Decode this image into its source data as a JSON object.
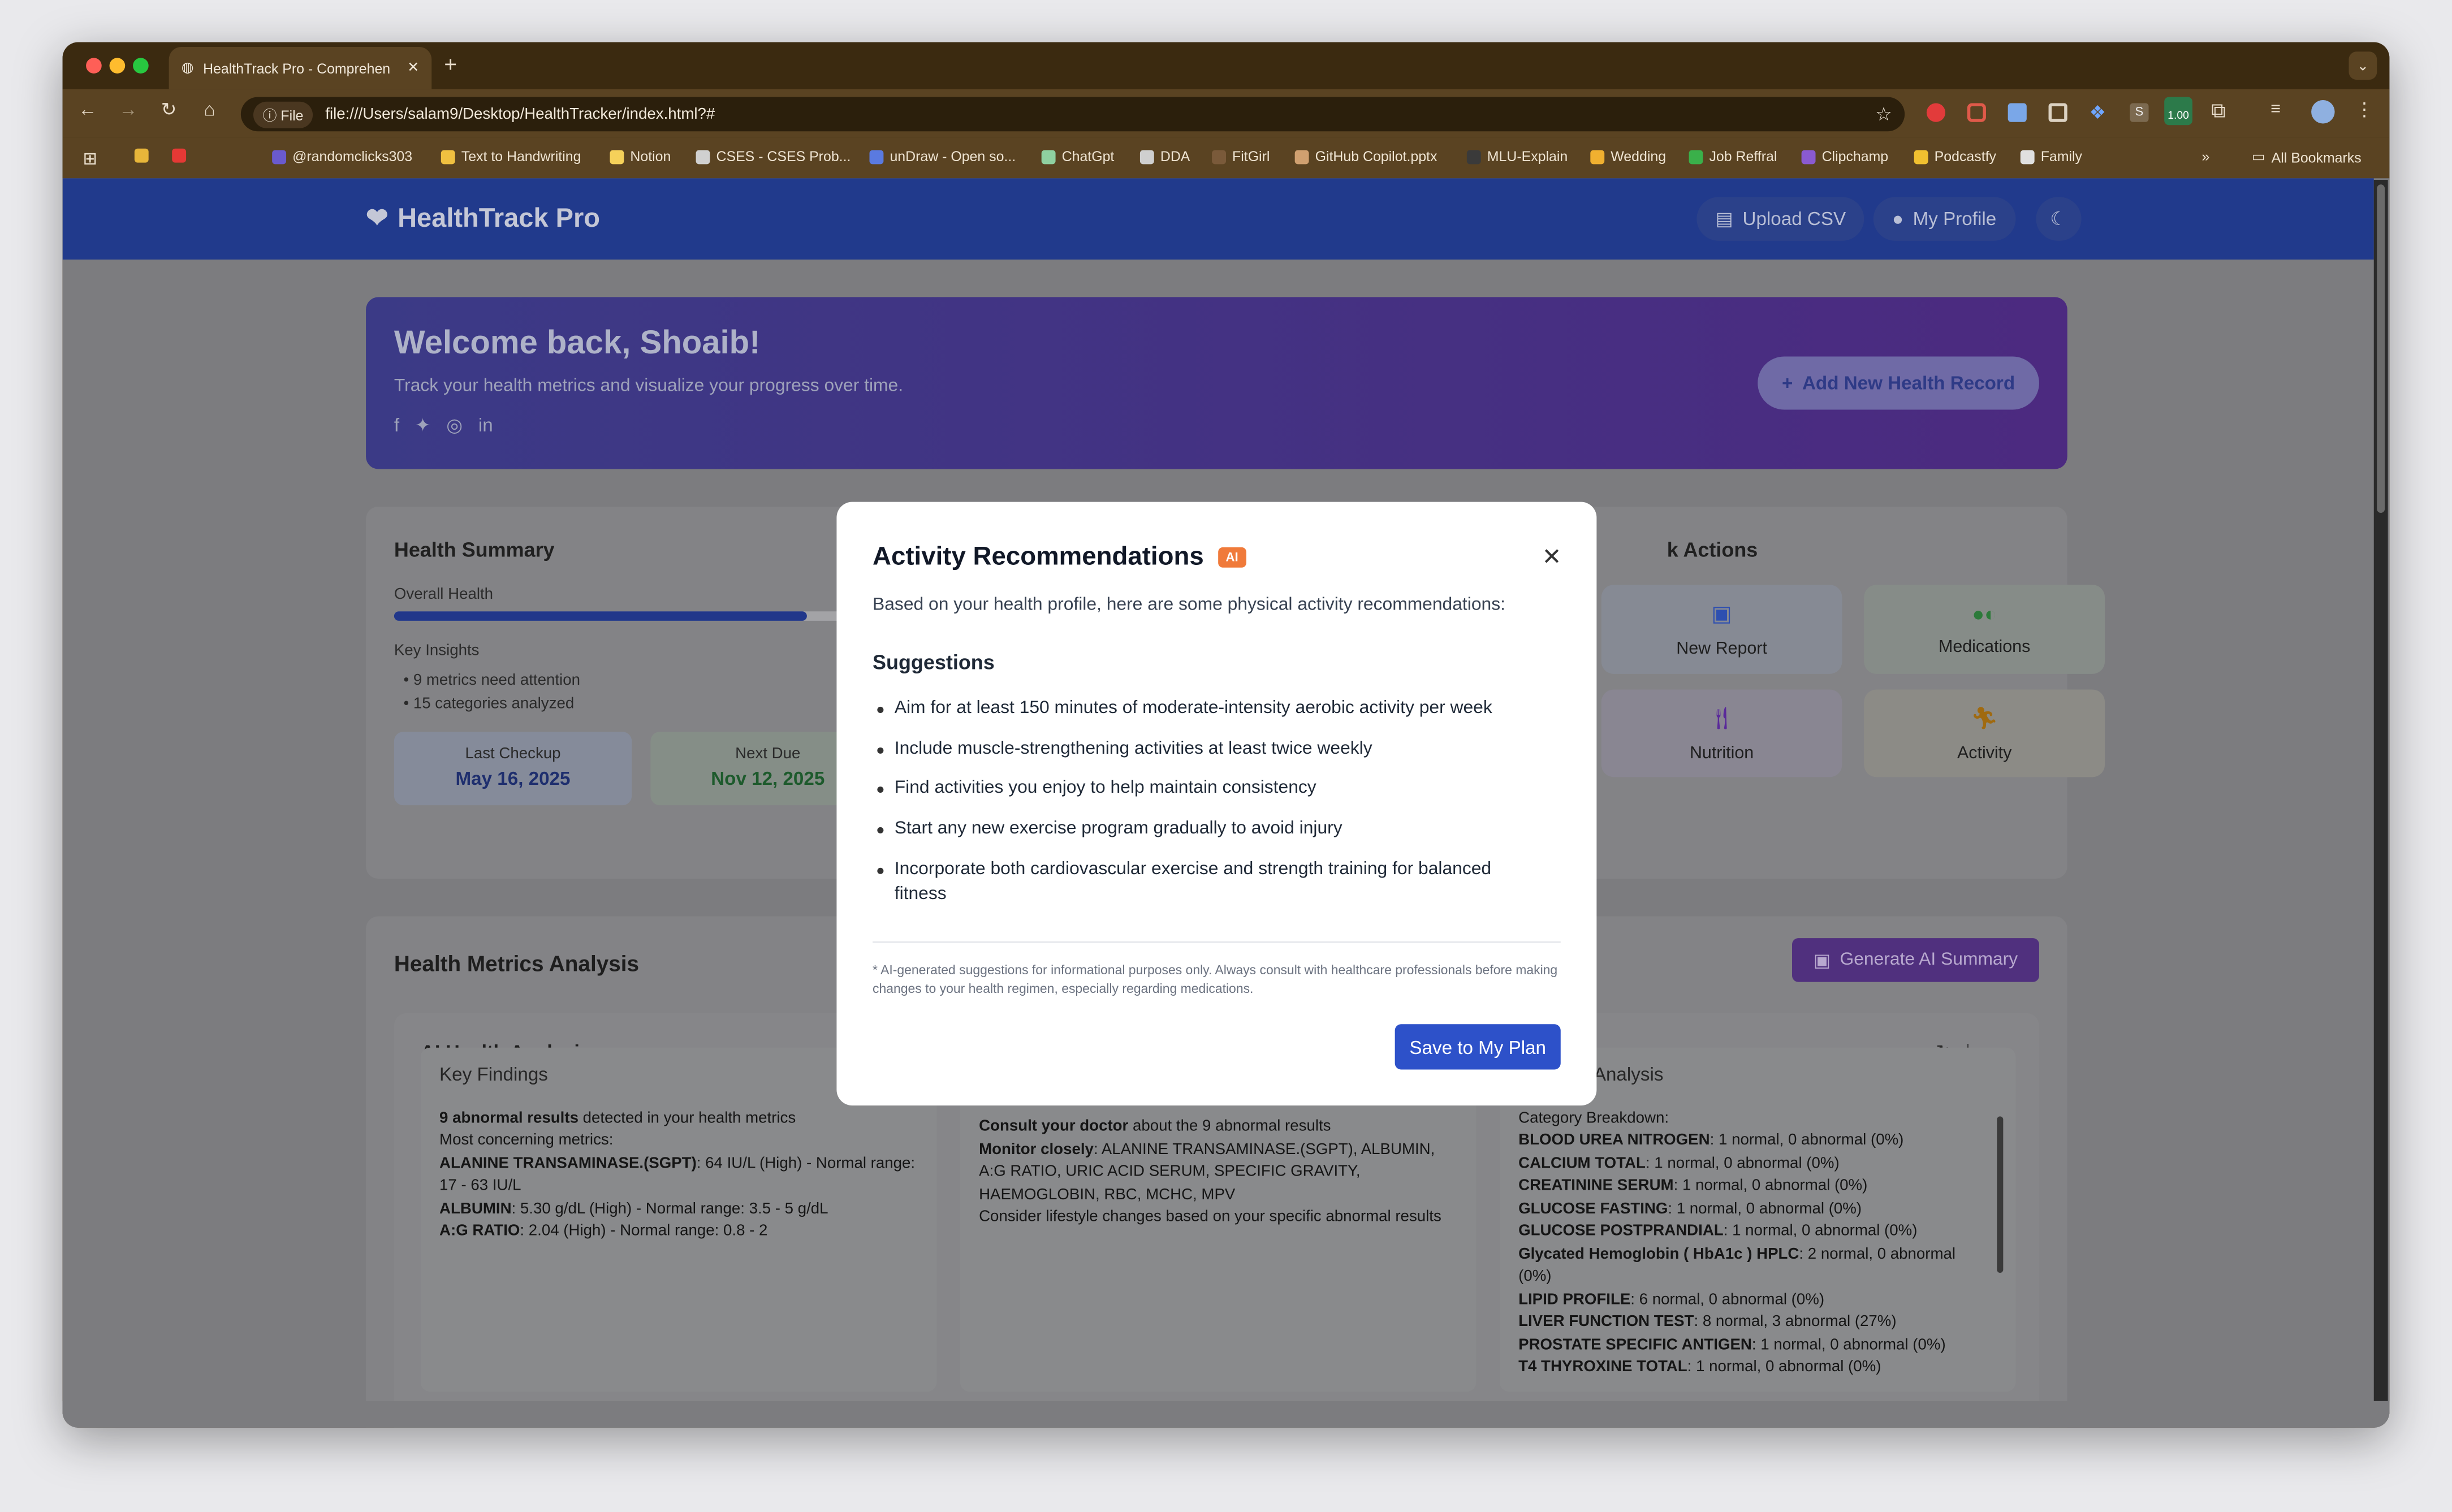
{
  "browser": {
    "tab_title": "HealthTrack Pro - Comprehen",
    "url_chip": "File",
    "url": "file:///Users/salam9/Desktop/HealthTracker/index.html?#",
    "ext_badge": "1.00",
    "bookmarks": [
      "@randomclicks303",
      "Text to Handwriting",
      "Notion",
      "CSES - CSES Prob...",
      "unDraw - Open so...",
      "ChatGpt",
      "DDA",
      "FitGirl",
      "GitHub Copilot.pptx",
      "MLU-Explain",
      "Wedding",
      "Job Reffral",
      "Clipchamp",
      "Podcastfy",
      "Family"
    ],
    "all_bookmarks": "All Bookmarks"
  },
  "header": {
    "logo": "HealthTrack Pro",
    "upload": "Upload CSV",
    "profile": "My Profile"
  },
  "welcome": {
    "title": "Welcome back, Shoaib!",
    "subtitle": "Track your health metrics and visualize your progress over time.",
    "add_button": "Add New Health Record"
  },
  "summary": {
    "title": "Health Summary",
    "overall_label": "Overall Health",
    "overall_value": 0.88,
    "insights_title": "Key Insights",
    "insights": [
      "9 metrics need attention",
      "15 categories analyzed"
    ],
    "last_checkup_label": "Last Checkup",
    "last_checkup": "May 16, 2025",
    "next_due_label": "Next Due",
    "next_due": "Nov 12, 2025"
  },
  "quick_actions": {
    "title_fragment": "k Actions",
    "items": [
      "New Report",
      "Medications",
      "Nutrition",
      "Activity"
    ]
  },
  "metrics": {
    "title": "Health Metrics Analysis",
    "generate_button": "Generate AI Summary",
    "ai_title": "AI Health Analysis"
  },
  "findings": {
    "title": "Key Findings",
    "line1_bold": "9 abnormal results",
    "line1_rest": " detected in your health metrics",
    "line2": "Most concerning metrics:",
    "items": [
      {
        "name": "ALANINE TRANSAMINASE.(SGPT)",
        "text": ": 64 IU/L (High) - Normal range: 17 - 63 IU/L"
      },
      {
        "name": "ALBUMIN",
        "text": ": 5.30 g/dL (High) - Normal range: 3.5 - 5 g/dL"
      },
      {
        "name": "A:G RATIO",
        "text": ": 2.04 (High) - Normal range: 0.8 - 2"
      }
    ]
  },
  "recs": {
    "c1_bold": "Consult your doctor",
    "c1_rest": " about the 9 abnormal results",
    "c2_bold": "Monitor closely",
    "c2_rest": ": ALANINE TRANSAMINASE.(SGPT), ALBUMIN, A:G RATIO, URIC ACID SERUM, SPECIFIC GRAVITY, HAEMOGLOBIN, RBC, MCHC, MPV",
    "c3": "Consider lifestyle changes based on your specific abnormal results"
  },
  "analysis": {
    "title_fragment": "Analysis",
    "breakdown_label": "Category Breakdown:",
    "items": [
      {
        "name": "BLOOD UREA NITROGEN",
        "text": ": 1 normal, 0 abnormal (0%)"
      },
      {
        "name": "CALCIUM TOTAL",
        "text": ": 1 normal, 0 abnormal (0%)"
      },
      {
        "name": "CREATININE SERUM",
        "text": ": 1 normal, 0 abnormal (0%)"
      },
      {
        "name": "GLUCOSE FASTING",
        "text": ": 1 normal, 0 abnormal (0%)"
      },
      {
        "name": "GLUCOSE POSTPRANDIAL",
        "text": ": 1 normal, 0 abnormal (0%)"
      },
      {
        "name": "Glycated Hemoglobin ( HbA1c ) HPLC",
        "text": ": 2 normal, 0 abnormal (0%)"
      },
      {
        "name": "LIPID PROFILE",
        "text": ": 6 normal, 0 abnormal (0%)"
      },
      {
        "name": "LIVER FUNCTION TEST",
        "text": ": 8 normal, 3 abnormal (27%)"
      },
      {
        "name": "PROSTATE SPECIFIC ANTIGEN",
        "text": ": 1 normal, 0 abnormal (0%)"
      },
      {
        "name": "T4 THYROXINE TOTAL",
        "text": ": 1 normal, 0 abnormal (0%)"
      }
    ]
  },
  "modal": {
    "title": "Activity Recommendations",
    "badge": "AI",
    "intro": "Based on your health profile, here are some physical activity recommendations:",
    "suggestions_title": "Suggestions",
    "suggestions": [
      "Aim for at least 150 minutes of moderate-intensity aerobic activity per week",
      "Include muscle-strengthening activities at least twice weekly",
      "Find activities you enjoy to help maintain consistency",
      "Start any new exercise program gradually to avoid injury",
      "Incorporate both cardiovascular exercise and strength training for balanced fitness"
    ],
    "disclaimer": "* AI-generated suggestions for informational purposes only. Always consult with healthcare professionals before making changes to your health regimen, especially regarding medications.",
    "save_button": "Save to My Plan"
  },
  "colors": {
    "header": "#213a8c",
    "primary": "#2d51c9",
    "purple": "#7b2fbe",
    "ai_badge": "#f07a3a"
  }
}
